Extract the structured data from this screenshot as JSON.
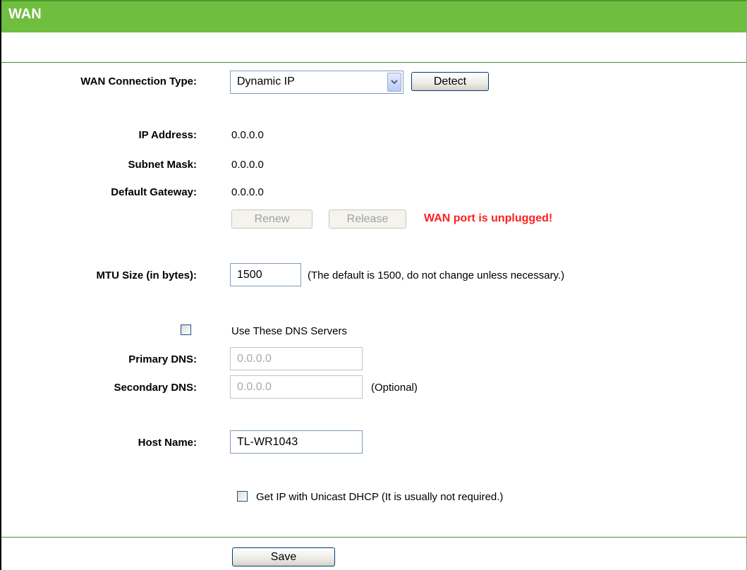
{
  "header": {
    "title": "WAN"
  },
  "connection_type": {
    "label": "WAN Connection Type:",
    "selected": "Dynamic IP",
    "detect_label": "Detect"
  },
  "status": {
    "ip_label": "IP Address:",
    "ip_value": "0.0.0.0",
    "mask_label": "Subnet Mask:",
    "mask_value": "0.0.0.0",
    "gateway_label": "Default Gateway:",
    "gateway_value": "0.0.0.0",
    "renew_label": "Renew",
    "release_label": "Release",
    "warning": "WAN port is unplugged!"
  },
  "mtu": {
    "label": "MTU Size (in bytes):",
    "value": "1500",
    "hint": "(The default is 1500, do not change unless necessary.)"
  },
  "dns": {
    "use_label": "Use These DNS Servers",
    "primary_label": "Primary DNS:",
    "primary_value": "0.0.0.0",
    "secondary_label": "Secondary DNS:",
    "secondary_value": "0.0.0.0",
    "optional": "(Optional)"
  },
  "host": {
    "label": "Host Name:",
    "value": "TL-WR1043"
  },
  "unicast": {
    "label": "Get IP with Unicast DHCP (It is usually not required.)"
  },
  "footer": {
    "save_label": "Save"
  }
}
